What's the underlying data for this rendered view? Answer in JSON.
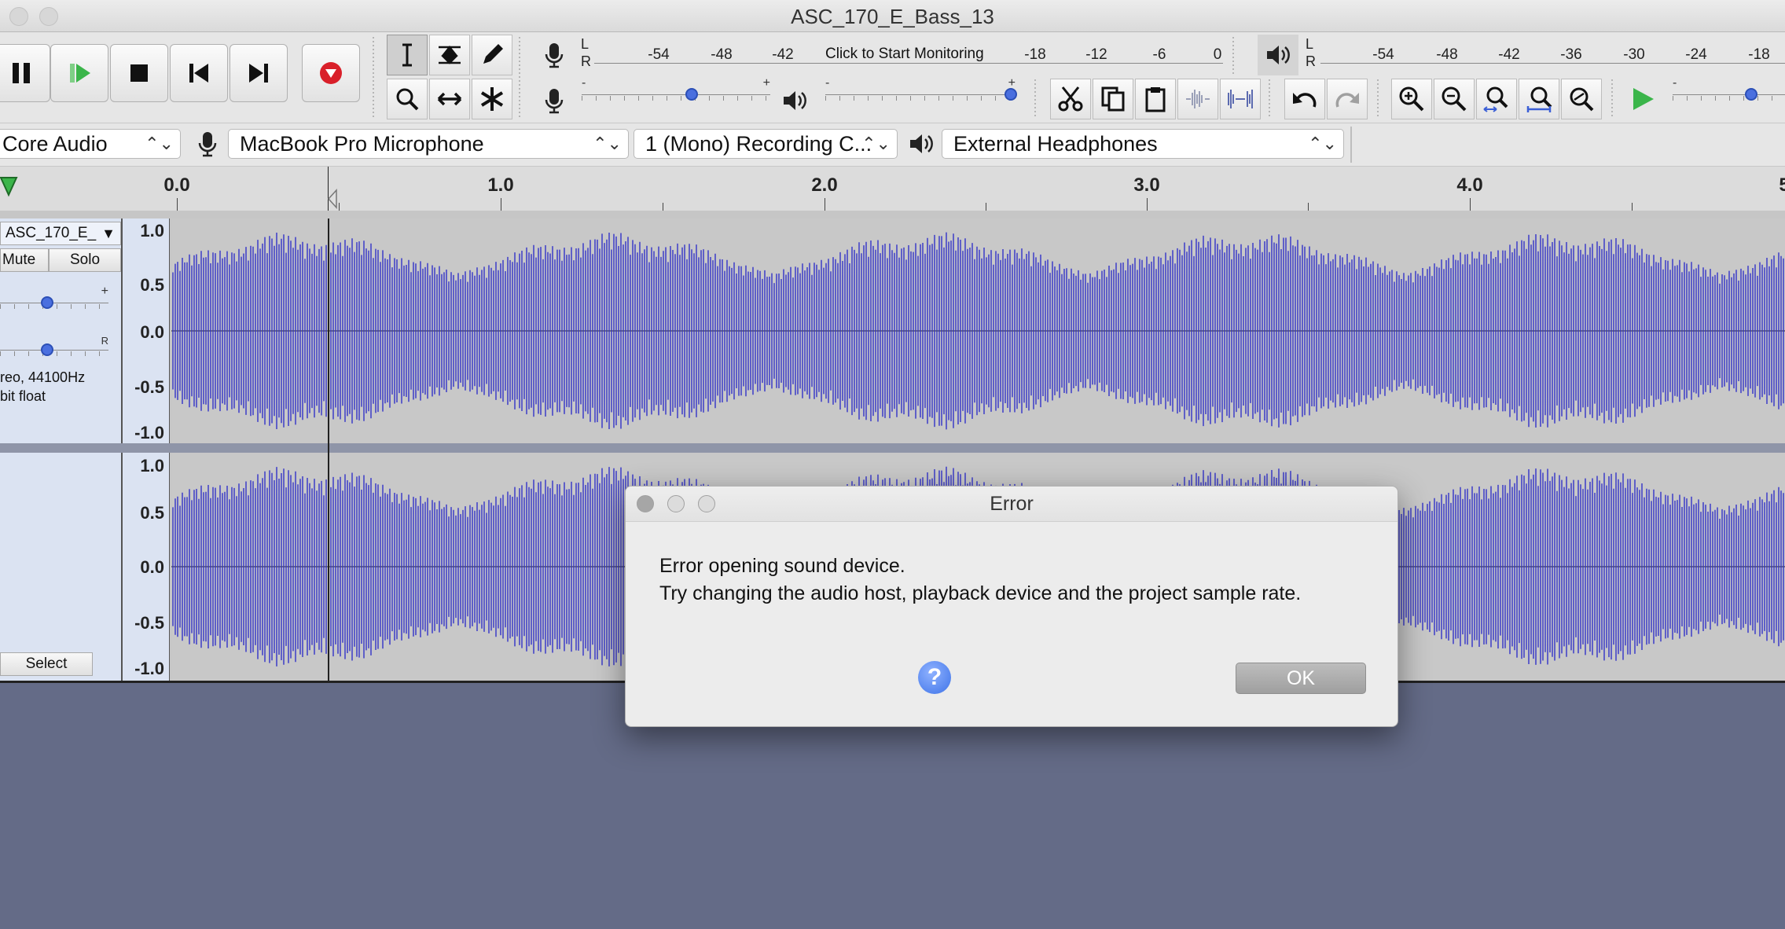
{
  "window": {
    "title": "ASC_170_E_Bass_13"
  },
  "record_meter": {
    "channels": [
      "L",
      "R"
    ],
    "ticks": [
      "-54",
      "-48",
      "-42",
      "-18",
      "-12",
      "-6",
      "0"
    ],
    "monitor_prompt": "Click to Start Monitoring"
  },
  "play_meter": {
    "channels": [
      "L",
      "R"
    ],
    "ticks": [
      "-54",
      "-48",
      "-42",
      "-36",
      "-30",
      "-24",
      "-18"
    ]
  },
  "mixer": {
    "minus": "-",
    "plus": "+"
  },
  "devices": {
    "host": "Core Audio",
    "recording_device": "MacBook Pro Microphone",
    "recording_channels": "1 (Mono) Recording C...",
    "playback_device": "External Headphones",
    "chevron": "⌃⌄"
  },
  "ruler": {
    "labels": [
      "0.0",
      "1.0",
      "2.0",
      "3.0",
      "4.0",
      "5"
    ]
  },
  "track": {
    "name": "ASC_170_E_",
    "mute_label": "Mute",
    "solo_label": "Solo",
    "gain_plus": "+",
    "pan_right": "R",
    "info_line1": "reo, 44100Hz",
    "info_line2": "bit float",
    "select_label": "Select",
    "scale": [
      "1.0",
      "0.5",
      "0.0",
      "-0.5",
      "-1.0"
    ]
  },
  "dialog": {
    "title": "Error",
    "line1": "Error opening sound device.",
    "line2": "Try changing the audio host, playback device and the project sample rate.",
    "help_label": "?",
    "ok_label": "OK"
  },
  "colors": {
    "waveform": "#3232c8",
    "background": "#646b87",
    "accent": "#4a6fdf",
    "record": "#d9202a",
    "play_green": "#3bb54a"
  },
  "icons": {
    "pause": "pause-icon",
    "play": "play-icon",
    "stop": "stop-icon",
    "skip_start": "skip-to-start-icon",
    "skip_end": "skip-to-end-icon",
    "record": "record-icon",
    "selection_tool": "selection-tool-icon",
    "envelope_tool": "envelope-tool-icon",
    "draw_tool": "draw-tool-icon",
    "zoom_tool": "zoom-tool-icon",
    "timeshift_tool": "time-shift-tool-icon",
    "multi_tool": "multi-tool-icon",
    "microphone": "microphone-icon",
    "speaker": "speaker-icon",
    "cut": "cut-icon",
    "copy": "copy-icon",
    "paste": "paste-icon",
    "trim": "trim-icon",
    "silence": "silence-icon",
    "undo": "undo-icon",
    "redo": "redo-icon",
    "zoom_in": "zoom-in-icon",
    "zoom_out": "zoom-out-icon",
    "fit_selection": "fit-selection-icon",
    "fit_project": "fit-project-icon",
    "zoom_toggle": "zoom-toggle-icon",
    "play_at_speed": "play-at-speed-icon"
  }
}
